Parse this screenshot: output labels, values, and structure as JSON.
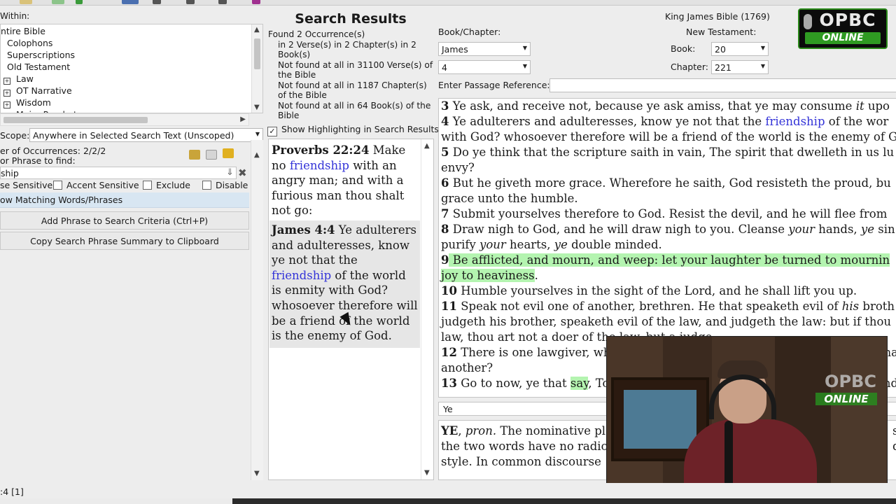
{
  "left": {
    "within_label": "Within:",
    "tree": [
      {
        "label": "ntire Bible",
        "box": false,
        "indent": false
      },
      {
        "label": "Colophons",
        "box": false,
        "indent": true
      },
      {
        "label": "Superscriptions",
        "box": false,
        "indent": true
      },
      {
        "label": "Old Testament",
        "box": false,
        "indent": true
      },
      {
        "label": "Law",
        "box": true,
        "indent": false
      },
      {
        "label": "OT Narrative",
        "box": true,
        "indent": false
      },
      {
        "label": "Wisdom",
        "box": true,
        "indent": false
      },
      {
        "label": "Major Prophets",
        "box": true,
        "indent": false
      }
    ],
    "scope_label": "Scope:",
    "scope_value": "Anywhere in Selected Search Text (Unscoped)",
    "occurrences_label": "er of Occurrences: 2/2/2",
    "phrase_label": "or Phrase to find:",
    "phrase_value": "ship",
    "opt_case": "se Sensitive",
    "opt_accent": "Accent Sensitive",
    "opt_exclude": "Exclude",
    "opt_disable": "Disable",
    "match_label": "ow Matching Words/Phrases",
    "add_phrase_button": "Add Phrase to Search Criteria (Ctrl+P)",
    "copy_button": "Copy Search Phrase Summary to Clipboard",
    "status": ":4 [1]"
  },
  "middle": {
    "title": "Search Results",
    "found": "Found 2 Occurrence(s)",
    "in_verses": "in 2 Verse(s) in 2 Chapter(s) in 2 Book(s)",
    "nf_verses": "Not found at all in 31100 Verse(s) of the Bible",
    "nf_chapters": "Not found at all in 1187 Chapter(s) of the Bible",
    "nf_books": "Not found at all in 64 Book(s) of the Bible",
    "show_highlighting": "Show Highlighting in Search Results",
    "results": [
      {
        "ref": "Proverbs 22:24",
        "pre": " Make no ",
        "hl": "friendship",
        "post": " with an angry man; and with a furious man thou shalt not go:"
      },
      {
        "ref": "James 4:4",
        "pre": " Ye adulterers and adulteresses, know ye not that the ",
        "hl": "friendship",
        "post": " of the world is enmity with God? whosoever therefore will be a friend of the world is the enemy of God."
      }
    ]
  },
  "right": {
    "version": "King James Bible (1769)",
    "book_chapter_label": "Book/Chapter:",
    "book_value": "James",
    "chapter_value": "4",
    "nt_label": "New Testament:",
    "book_label": "Book:",
    "book_num": "20",
    "chapter_label": "Chapter:",
    "chapter_num": "221",
    "passage_label": "Enter Passage Reference:",
    "word_field": "Ye",
    "dict_line1_head": "YE",
    "dict_line1_pos": "pron.",
    "dict_line1_rest": " The nominative pl",
    "dict_line1_tail": "si",
    "dict_line2": "the two words have no radic",
    "dict_line2_tail": "d",
    "dict_line3": "style. In common discourse"
  },
  "verses": [
    {
      "n": "3",
      "parts": [
        {
          "t": " Ye ask, and receive not, because ye ask amiss, that ye may consume "
        },
        {
          "t": "it",
          "i": true
        },
        {
          "t": " upo"
        }
      ]
    },
    {
      "n": "4",
      "parts": [
        {
          "t": " Ye adulterers and adulteresses, know ye not that the "
        },
        {
          "t": "friendship",
          "b": true
        },
        {
          "t": " of the wor"
        }
      ]
    },
    {
      "n": "",
      "parts": [
        {
          "t": "with God? whosoever therefore will be a friend of the world is the enemy of G"
        }
      ]
    },
    {
      "n": "5",
      "parts": [
        {
          "t": " Do ye think that the scripture saith in vain, The spirit that dwelleth in us lu"
        }
      ]
    },
    {
      "n": "",
      "parts": [
        {
          "t": "envy?"
        }
      ]
    },
    {
      "n": "6",
      "parts": [
        {
          "t": " But he giveth more grace. Wherefore he saith, God resisteth the proud, bu"
        }
      ]
    },
    {
      "n": "",
      "parts": [
        {
          "t": "grace unto the humble."
        }
      ]
    },
    {
      "n": "7",
      "parts": [
        {
          "t": " Submit yourselves therefore to God. Resist the devil, and he will flee from"
        }
      ]
    },
    {
      "n": "8",
      "parts": [
        {
          "t": " Draw nigh to God, and he will draw nigh to you. Cleanse "
        },
        {
          "t": "your",
          "i": true
        },
        {
          "t": " hands, "
        },
        {
          "t": "ye",
          "i": true
        },
        {
          "t": " sin"
        }
      ]
    },
    {
      "n": "",
      "parts": [
        {
          "t": "purify "
        },
        {
          "t": "your",
          "i": true
        },
        {
          "t": " hearts, "
        },
        {
          "t": "ye",
          "i": true
        },
        {
          "t": " double minded."
        }
      ]
    },
    {
      "n": "9",
      "parts": [
        {
          "t": " Be afflicted, and mourn, and weep: let your laughter be turned to mournin",
          "g": true
        }
      ]
    },
    {
      "n": "",
      "parts": [
        {
          "t": "joy to heaviness",
          "g": true
        },
        {
          "t": "."
        }
      ]
    },
    {
      "n": "10",
      "parts": [
        {
          "t": " Humble yourselves in the sight of the Lord, and he shall lift you up."
        }
      ]
    },
    {
      "n": "11",
      "parts": [
        {
          "t": " Speak not evil one of another, brethren. He that speaketh evil of "
        },
        {
          "t": "his",
          "i": true
        },
        {
          "t": " broth"
        }
      ]
    },
    {
      "n": "",
      "parts": [
        {
          "t": "judgeth his brother, speaketh evil of the law, and judgeth the law: but if thou"
        }
      ]
    },
    {
      "n": "",
      "parts": [
        {
          "t": "law, thou art not a doer of the law, but a judge."
        }
      ]
    },
    {
      "n": "12",
      "parts": [
        {
          "t": " There is one lawgiver, who is able to save and to destroy: who art thou that"
        }
      ]
    },
    {
      "n": "",
      "parts": [
        {
          "t": "another?"
        }
      ]
    },
    {
      "n": "13",
      "parts": [
        {
          "t": " Go to now, ye that "
        },
        {
          "t": "say",
          "g": true
        },
        {
          "t": ", To day or to morrow we will go into such a city, and"
        }
      ]
    }
  ],
  "logo": {
    "top": "OPBC",
    "bottom": "ONLINE"
  },
  "colors": {
    "highlight_green": "#b4f4b0",
    "search_blue": "#3434d8",
    "logo_green": "#2f9a22"
  }
}
